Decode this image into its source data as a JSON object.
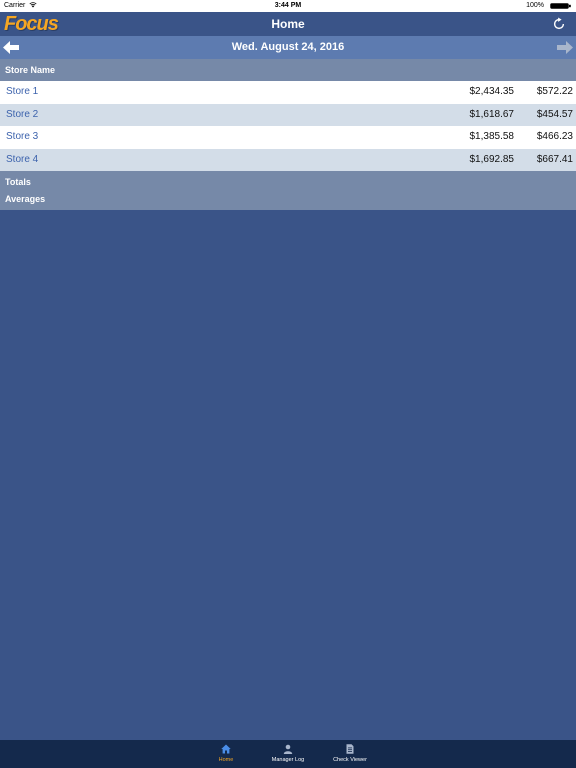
{
  "status_bar": {
    "carrier": "Carrier",
    "time": "3:44 PM",
    "battery": "100%"
  },
  "header": {
    "logo": "Focus",
    "title": "Home"
  },
  "date_bar": {
    "date": "Wed. August 24, 2016"
  },
  "table": {
    "column_header": "Store Name",
    "rows": [
      {
        "name": "Store 1",
        "value1": "$2,434.35",
        "value2": "$572.22"
      },
      {
        "name": "Store 2",
        "value1": "$1,618.67",
        "value2": "$454.57"
      },
      {
        "name": "Store 3",
        "value1": "$1,385.58",
        "value2": "$466.23"
      },
      {
        "name": "Store 4",
        "value1": "$1,692.85",
        "value2": "$667.41"
      }
    ],
    "totals_label": "Totals",
    "averages_label": "Averages"
  },
  "tab_bar": {
    "tabs": [
      {
        "label": "Home",
        "icon": "home-icon",
        "active": true
      },
      {
        "label": "Manager Log",
        "icon": "person-icon",
        "active": false
      },
      {
        "label": "Check Viewer",
        "icon": "document-icon",
        "active": false
      }
    ]
  },
  "colors": {
    "background": "#3a5488",
    "accent": "#f5a623",
    "link": "#3d63ad",
    "date_bar": "#5d7bb0",
    "header_row": "#7689a8",
    "tab_bar": "#14294c"
  }
}
